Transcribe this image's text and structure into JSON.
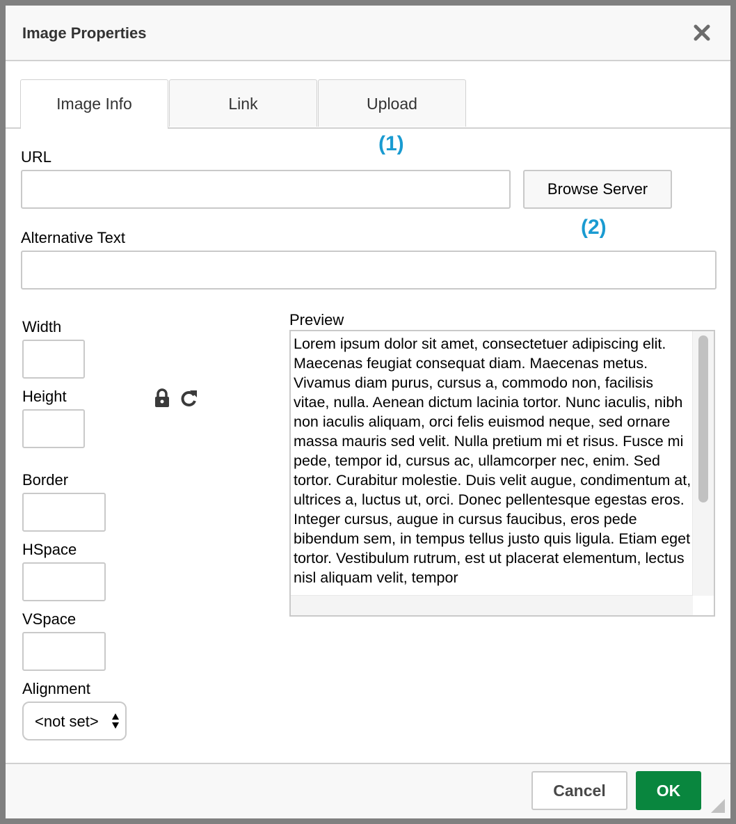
{
  "dialog": {
    "title": "Image Properties",
    "close_icon": "close-icon"
  },
  "tabs": [
    {
      "label": "Image Info",
      "active": true
    },
    {
      "label": "Link",
      "active": false
    },
    {
      "label": "Upload",
      "active": false
    }
  ],
  "annotations": {
    "one": "(1)",
    "two": "(2)",
    "color": "#1a9bd1"
  },
  "fields": {
    "url": {
      "label": "URL",
      "value": "",
      "placeholder": ""
    },
    "browse_server": "Browse Server",
    "alt_text": {
      "label": "Alternative Text",
      "value": ""
    },
    "width": {
      "label": "Width",
      "value": ""
    },
    "height": {
      "label": "Height",
      "value": ""
    },
    "lock_icon": "lock-icon",
    "reset_icon": "reset-size-icon",
    "border": {
      "label": "Border",
      "value": ""
    },
    "hspace": {
      "label": "HSpace",
      "value": ""
    },
    "vspace": {
      "label": "VSpace",
      "value": ""
    },
    "alignment": {
      "label": "Alignment",
      "selected": "<not set>"
    }
  },
  "preview": {
    "label": "Preview",
    "text": "Lorem ipsum dolor sit amet, consectetuer adipiscing elit. Maecenas feugiat consequat diam. Maecenas metus. Vivamus diam purus, cursus a, commodo non, facilisis vitae, nulla. Aenean dictum lacinia tortor. Nunc iaculis, nibh non iaculis aliquam, orci felis euismod neque, sed ornare massa mauris sed velit. Nulla pretium mi et risus. Fusce mi pede, tempor id, cursus ac, ullamcorper nec, enim. Sed tortor. Curabitur molestie. Duis velit augue, condimentum at, ultrices a, luctus ut, orci. Donec pellentesque egestas eros. Integer cursus, augue in cursus faucibus, eros pede bibendum sem, in tempus tellus justo quis ligula. Etiam eget tortor. Vestibulum rutrum, est ut placerat elementum, lectus nisl aliquam velit, tempor"
  },
  "footer": {
    "cancel": "Cancel",
    "ok": "OK",
    "ok_color": "#09863e"
  }
}
